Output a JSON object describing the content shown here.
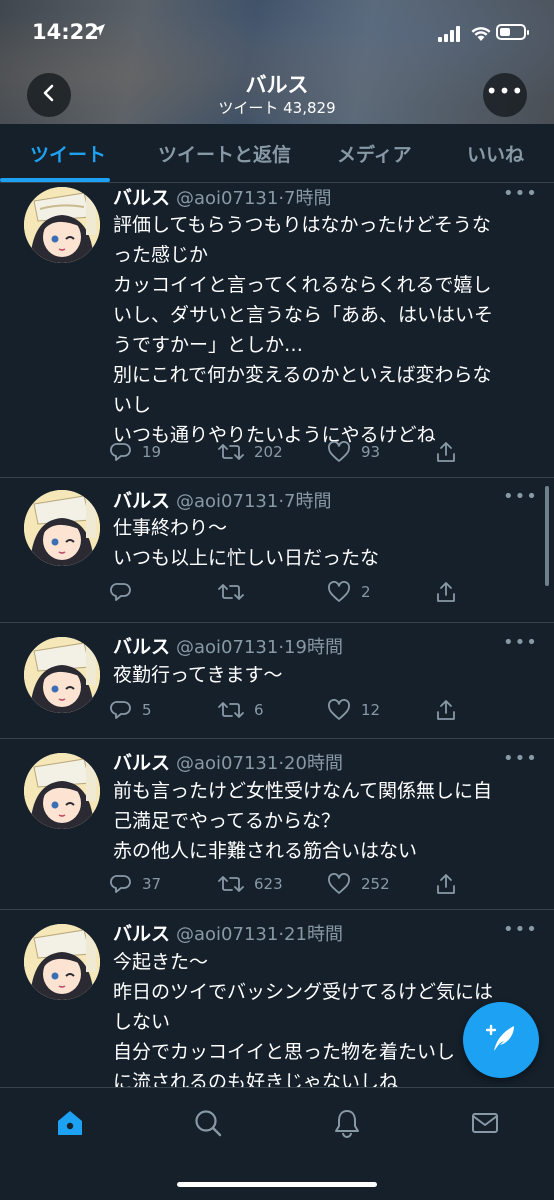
{
  "status_bar": {
    "time": "14:22"
  },
  "header": {
    "title": "バルス",
    "subtitle": "ツイート 43,829"
  },
  "tabs": [
    "ツイート",
    "ツイートと返信",
    "メディア",
    "いいね"
  ],
  "tweets": [
    {
      "name": "バルス",
      "handle": "@aoi07131·7時間",
      "lines": [
        "評価してもらうつもりはなかったけどそうな",
        "った感じか",
        "カッコイイと言ってくれるならくれるで嬉し",
        "いし、ダサいと言うなら「ああ、はいはいそ",
        "うですかー」としか…",
        "別にこれで何か変えるのかといえば変わらな",
        "いし",
        "いつも通りやりたいようにやるけどね"
      ],
      "replies": "19",
      "retweets": "202",
      "likes": "93"
    },
    {
      "name": "バルス",
      "handle": "@aoi07131·7時間",
      "lines": [
        "仕事終わり〜",
        "いつも以上に忙しい日だったな"
      ],
      "replies": "",
      "retweets": "",
      "likes": "2"
    },
    {
      "name": "バルス",
      "handle": "@aoi07131·19時間",
      "lines": [
        "夜勤行ってきます〜"
      ],
      "replies": "5",
      "retweets": "6",
      "likes": "12"
    },
    {
      "name": "バルス",
      "handle": "@aoi07131·20時間",
      "lines": [
        "前も言ったけど女性受けなんて関係無しに自",
        "己満足でやってるからな？",
        "赤の他人に非難される筋合いはない"
      ],
      "replies": "37",
      "retweets": "623",
      "likes": "252"
    },
    {
      "name": "バルス",
      "handle": "@aoi07131·21時間",
      "lines": [
        "今起きた〜",
        "昨日のツイでバッシング受けてるけど気には",
        "しない",
        "自分でカッコイイと思った物を着たいし",
        "に流されるのも好きじゃないしね"
      ],
      "replies": "",
      "retweets": "",
      "likes": ""
    }
  ],
  "icons": {
    "back": "chevron-left-icon",
    "more": "more-horizontal-icon",
    "reply": "reply-icon",
    "retweet": "retweet-icon",
    "like": "heart-icon",
    "share": "share-icon",
    "compose": "compose-tweet-icon",
    "home": "home-icon",
    "search": "search-icon",
    "notifications": "bell-icon",
    "messages": "mail-icon"
  },
  "colors": {
    "background": "#15202b",
    "accent": "#1da1f2",
    "muted": "#8899a6",
    "divider": "#38444d"
  }
}
